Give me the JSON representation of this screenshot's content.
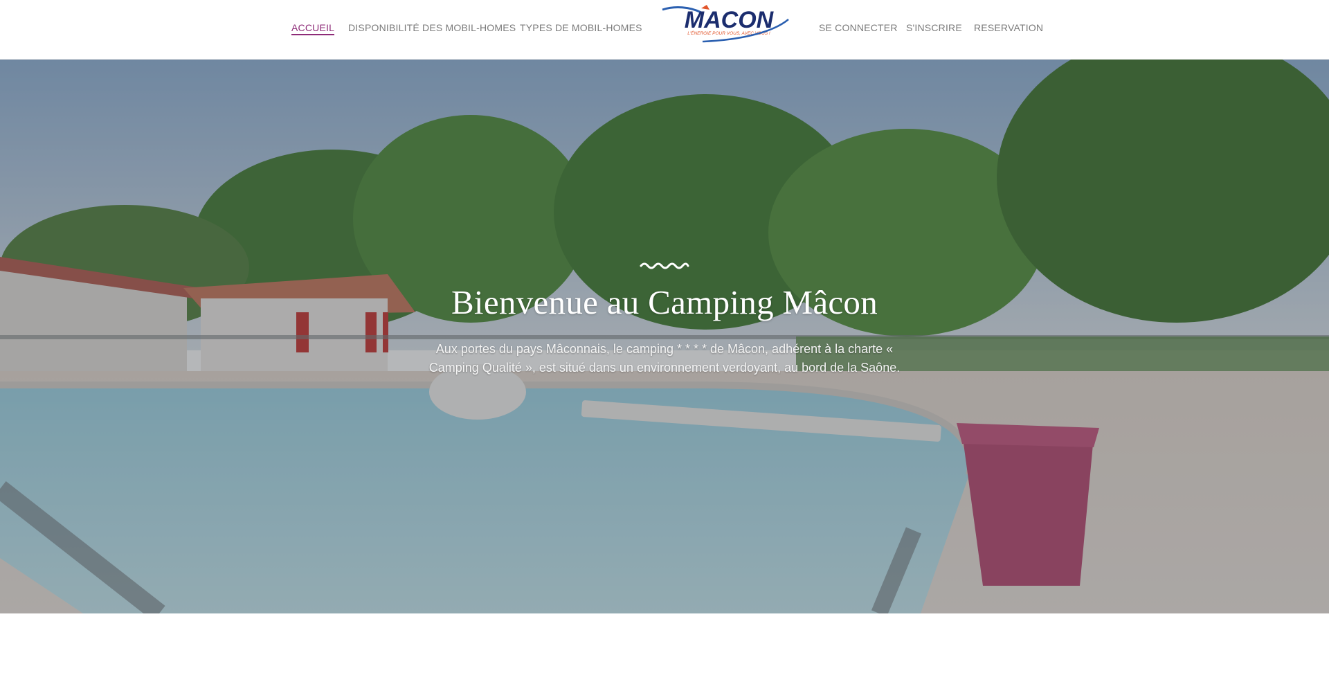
{
  "nav": {
    "left": [
      {
        "label": "ACCUEIL",
        "active": true
      },
      {
        "label": "DISPONIBILITÉ DES MOBIL-HOMES",
        "active": false
      },
      {
        "label": "TYPES DE MOBIL-HOMES",
        "active": false
      }
    ],
    "right": [
      {
        "label": "SE CONNECTER"
      },
      {
        "label": "S'INSCRIRE"
      },
      {
        "label": "RESERVATION"
      }
    ]
  },
  "logo": {
    "name": "MACON",
    "tagline": "L'ÉNERGIE POUR VOUS, AVEC VOUS !",
    "primary_color": "#1b2d6e",
    "accent_color": "#e2552b",
    "swoosh_color": "#2a5fb0"
  },
  "hero": {
    "icon": "wave-squiggle-icon",
    "title": "Bienvenue au Camping Mâcon",
    "text": "Aux portes du pays Mâconnais, le camping * * * * de Mâcon, adhérent à la charte « Camping Qualité », est situé dans un environnement verdoyant, au bord de la Saône."
  },
  "colors": {
    "active_nav": "#8e2b78",
    "nav_text": "#7a7a7a",
    "overlay": "rgba(60,66,72,0.38)"
  }
}
